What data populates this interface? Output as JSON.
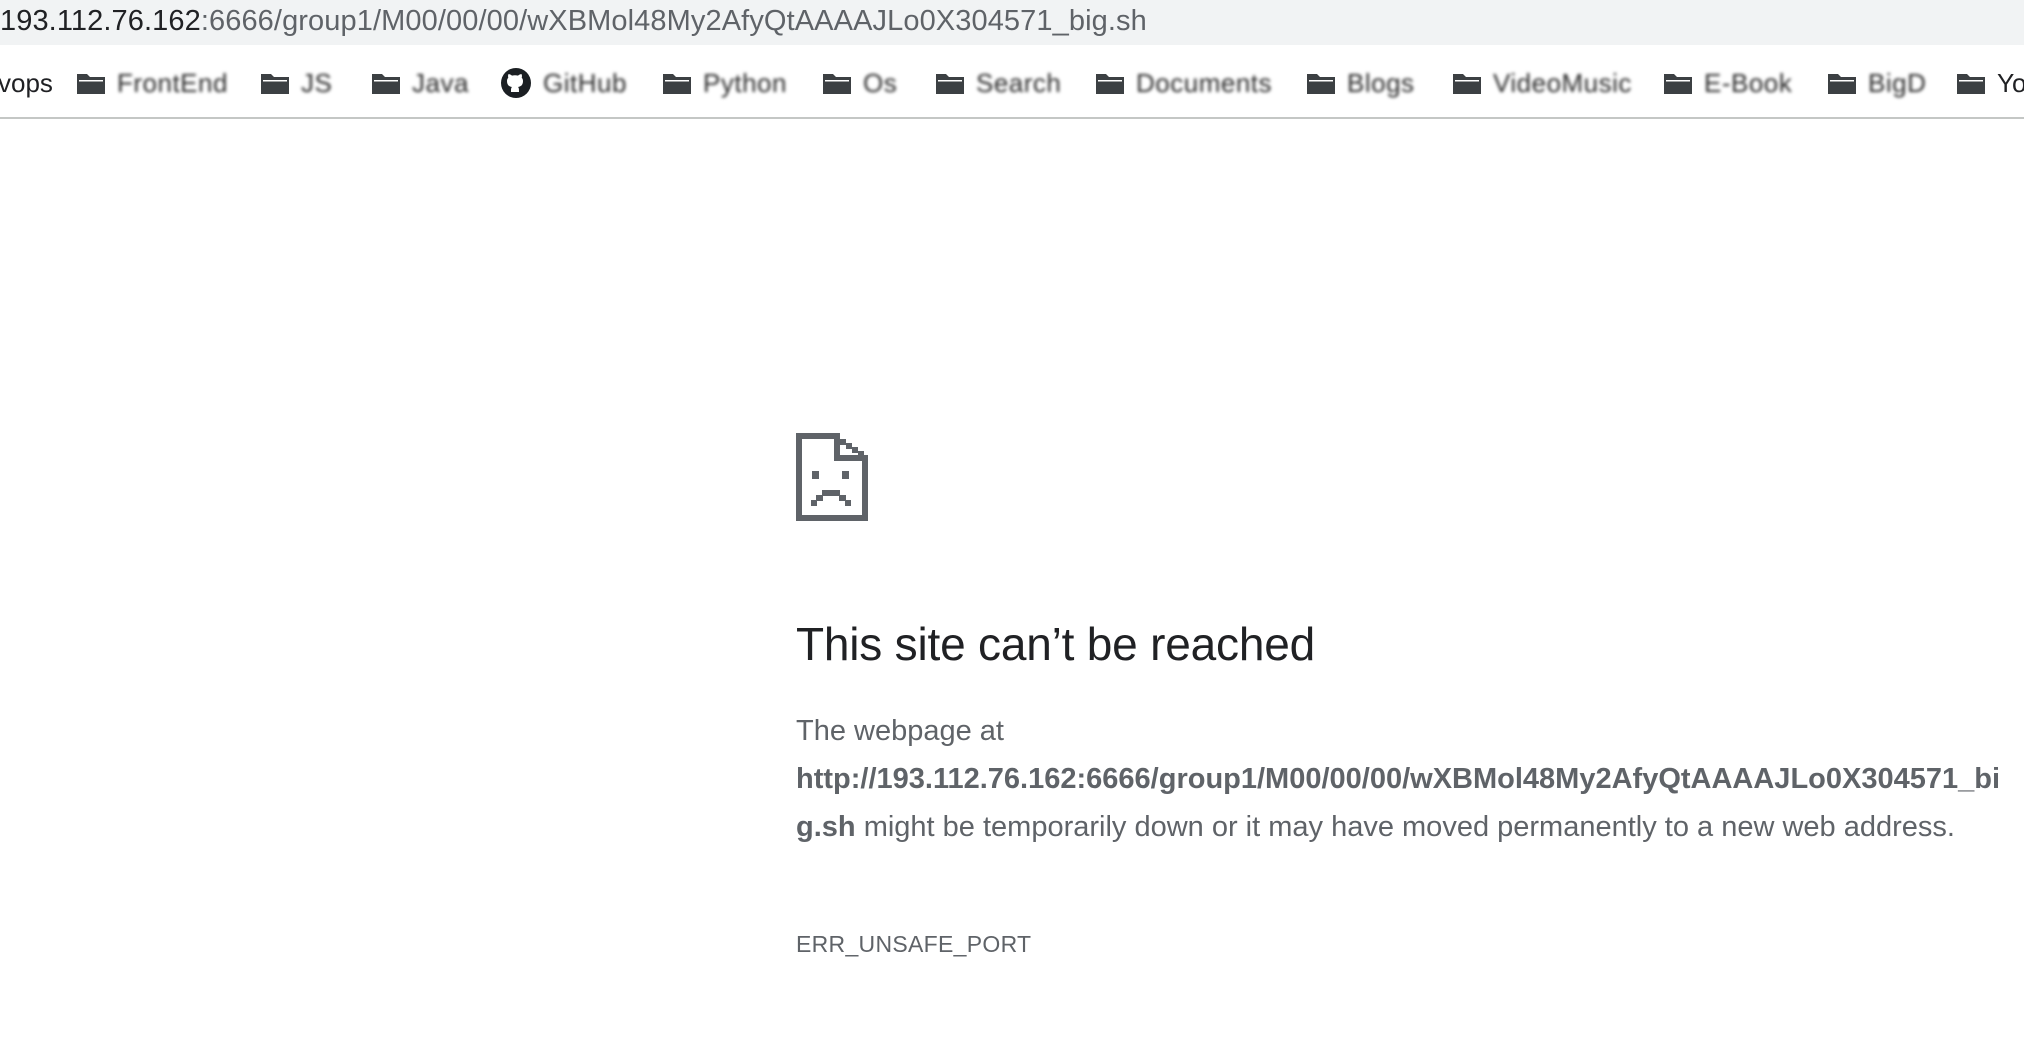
{
  "address_bar": {
    "host": "193.112.76.162",
    "path": ":6666/group1/M00/00/00/wXBMol48My2AfyQtAAAAJLo0X304571_big.sh"
  },
  "bookmarks": [
    {
      "label": "vops",
      "icon": "none"
    },
    {
      "label": "FrontEnd",
      "icon": "folder-icon"
    },
    {
      "label": "JS",
      "icon": "folder-icon"
    },
    {
      "label": "Java",
      "icon": "folder-icon"
    },
    {
      "label": "GitHub",
      "icon": "github-icon"
    },
    {
      "label": "Python",
      "icon": "folder-icon"
    },
    {
      "label": "Os",
      "icon": "folder-icon"
    },
    {
      "label": "Search",
      "icon": "folder-icon"
    },
    {
      "label": "Documents",
      "icon": "folder-icon"
    },
    {
      "label": "Blogs",
      "icon": "folder-icon"
    },
    {
      "label": "VideoMusic",
      "icon": "folder-icon"
    },
    {
      "label": "E-Book",
      "icon": "folder-icon"
    },
    {
      "label": "BigD",
      "icon": "folder-icon"
    },
    {
      "label": "Yo",
      "icon": "folder-icon"
    }
  ],
  "error": {
    "icon": "sad-page-icon",
    "title": "This site can’t be reached",
    "desc_prefix": "The webpage at",
    "url": "http://193.112.76.162:6666/group1/M00/00/00/wXBMol48My2AfyQtAAAAJLo0X304571_big.sh",
    "desc_suffix": "might be temporarily down or it may have moved permanently to a new web address.",
    "code": "ERR_UNSAFE_PORT"
  },
  "colors": {
    "text_primary": "#202124",
    "text_secondary": "#5f6368",
    "address_bar_bg": "#f1f3f4",
    "icon_gray": "#5f6368"
  }
}
